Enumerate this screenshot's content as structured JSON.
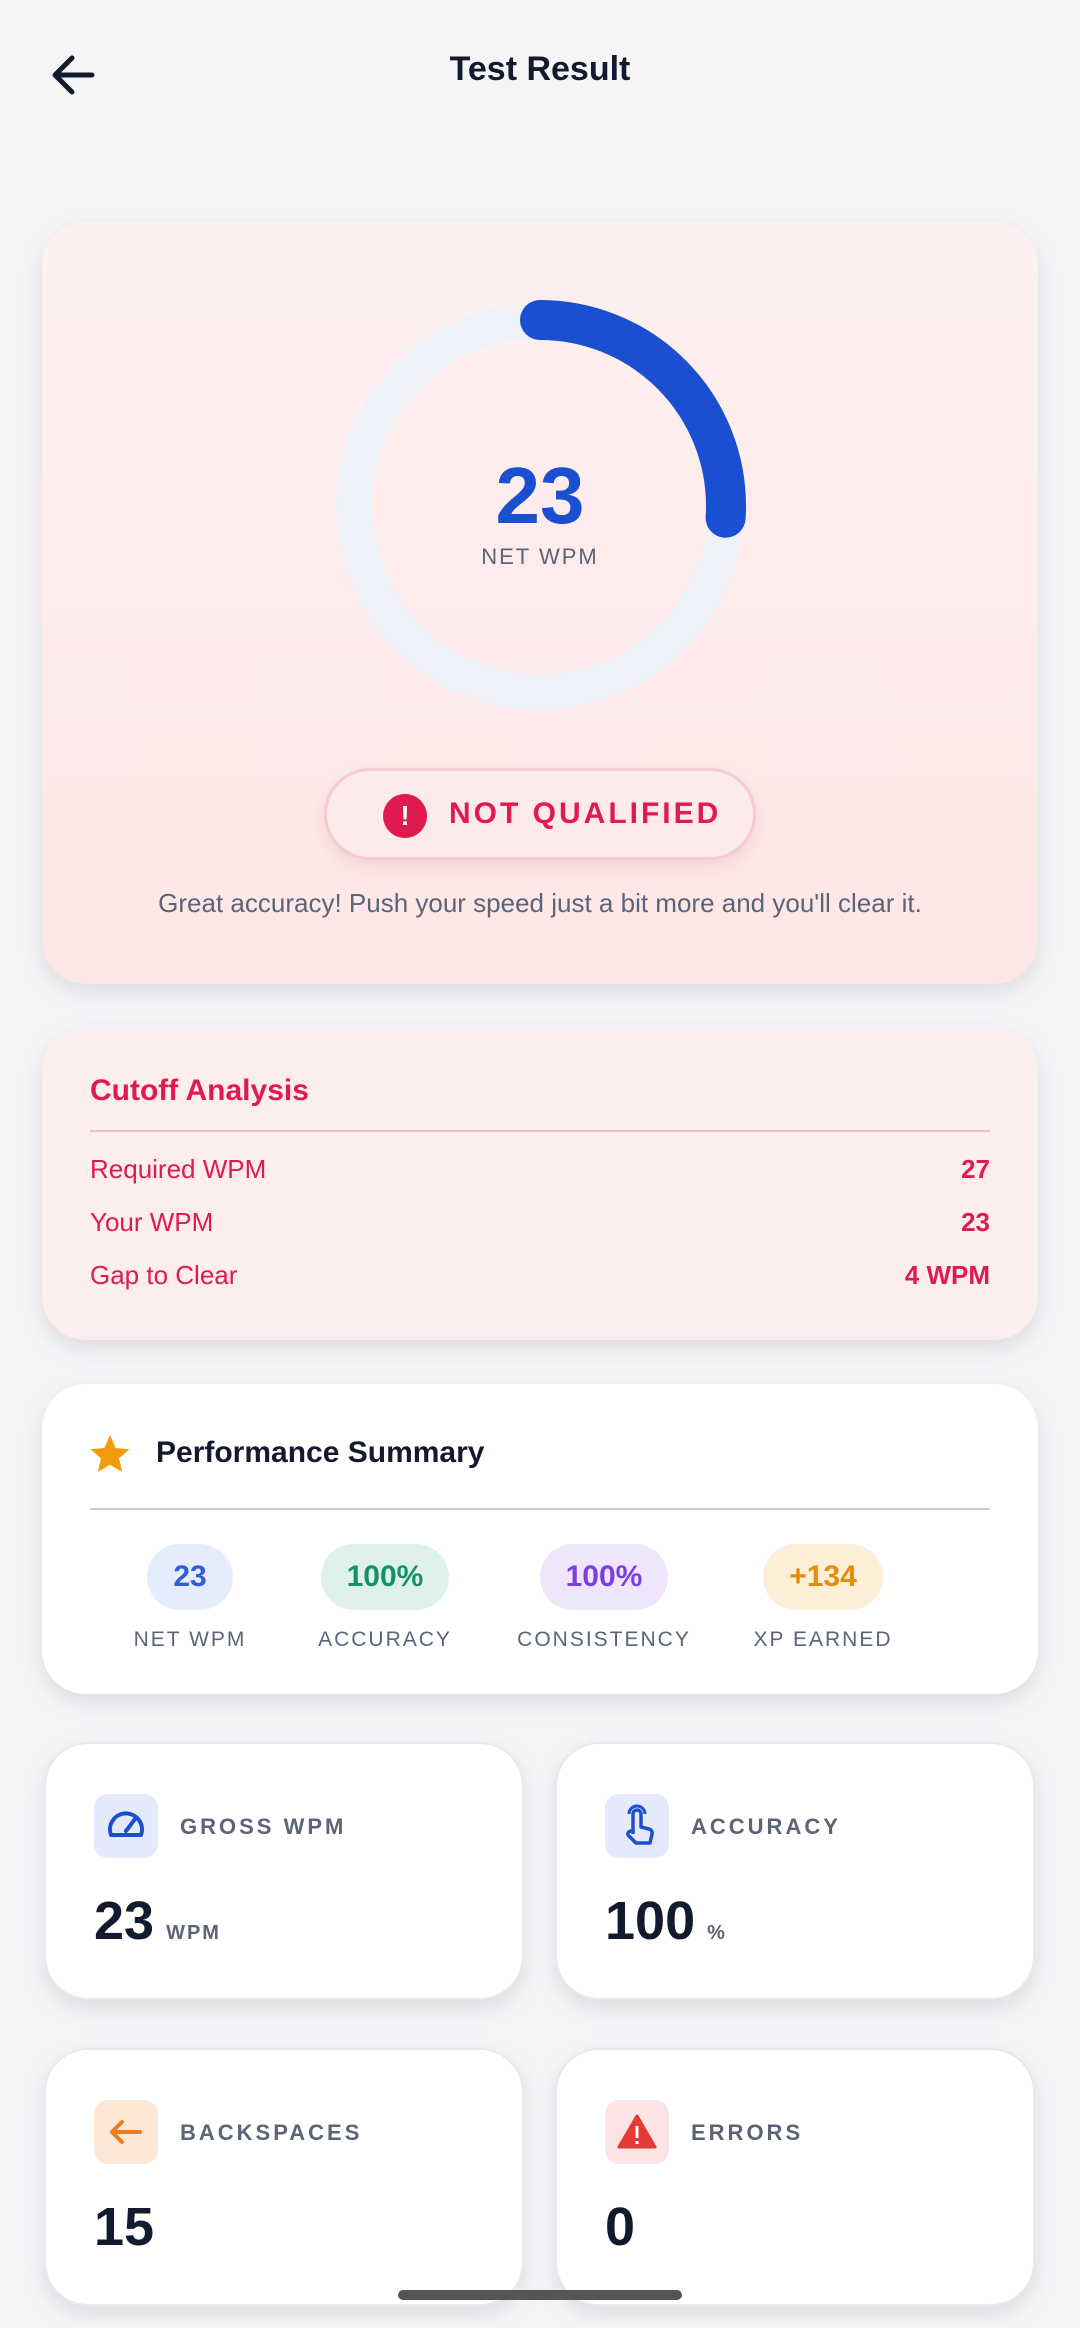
{
  "header": {
    "title": "Test Result"
  },
  "hero": {
    "net_wpm": "23",
    "net_wpm_label": "NET WPM",
    "progress_fraction": 0.26,
    "status": "NOT QUALIFIED",
    "status_icon": "exclamation-icon",
    "message": "Great accuracy! Push your speed just a bit more and you'll clear it.",
    "accent_color": "#1a4fd2",
    "status_color": "#e01a4f"
  },
  "cutoff": {
    "title": "Cutoff Analysis",
    "rows": [
      {
        "label": "Required WPM",
        "value": "27"
      },
      {
        "label": "Your WPM",
        "value": "23"
      },
      {
        "label": "Gap to Clear",
        "value": "4 WPM"
      }
    ]
  },
  "performance": {
    "title": "Performance Summary",
    "stats": [
      {
        "value": "23",
        "label": "NET WPM",
        "color": "#2f5fd8",
        "bg": "#e5ecfc"
      },
      {
        "value": "100%",
        "label": "ACCURACY",
        "color": "#149266",
        "bg": "#dff2ea"
      },
      {
        "value": "100%",
        "label": "CONSISTENCY",
        "color": "#7a3fe4",
        "bg": "#efe6fc"
      },
      {
        "value": "+134",
        "label": "XP EARNED",
        "color": "#e58c0a",
        "bg": "#fdeed8"
      }
    ]
  },
  "tiles": [
    {
      "label": "GROSS WPM",
      "value": "23",
      "unit": "WPM",
      "icon": "speedometer-icon"
    },
    {
      "label": "ACCURACY",
      "value": "100",
      "unit": "%",
      "icon": "touch-icon"
    },
    {
      "label": "BACKSPACES",
      "value": "15",
      "unit": "",
      "icon": "arrow-left-icon"
    },
    {
      "label": "ERRORS",
      "value": "0",
      "unit": "",
      "icon": "warning-icon"
    }
  ]
}
